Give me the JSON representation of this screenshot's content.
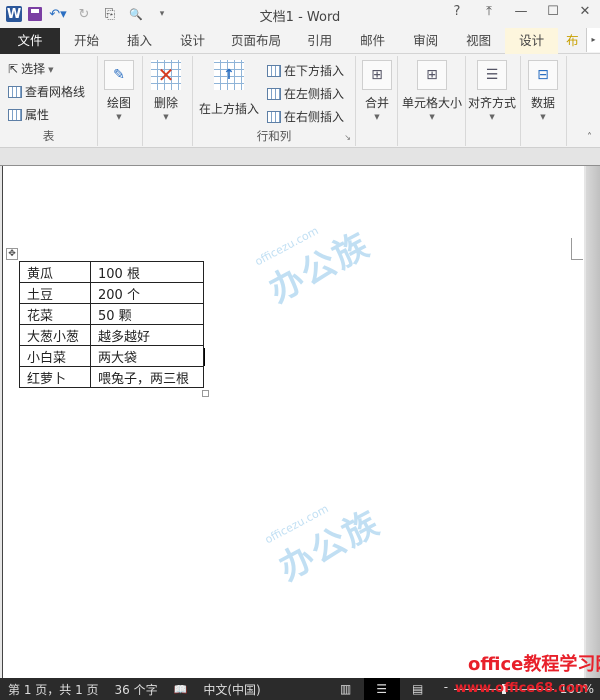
{
  "app": {
    "title": "文档1 - Word"
  },
  "quick_access": [
    {
      "name": "word-logo-icon",
      "glyph": "W"
    },
    {
      "name": "save-icon",
      "glyph": ""
    },
    {
      "name": "undo-icon",
      "glyph": "↶▾"
    },
    {
      "name": "redo-icon",
      "glyph": "↻"
    },
    {
      "name": "new-doc-icon",
      "glyph": "⎘"
    },
    {
      "name": "print-preview-icon",
      "glyph": "🔍"
    },
    {
      "name": "customize-icon",
      "glyph": "▾"
    }
  ],
  "window_controls": {
    "help": "?",
    "ribbon_display": "⤒",
    "minimize": "—",
    "maximize": "☐",
    "close": "✕"
  },
  "tabs": [
    {
      "label": "文件"
    },
    {
      "label": "开始"
    },
    {
      "label": "插入"
    },
    {
      "label": "设计"
    },
    {
      "label": "页面布局"
    },
    {
      "label": "引用"
    },
    {
      "label": "邮件"
    },
    {
      "label": "审阅"
    },
    {
      "label": "视图"
    },
    {
      "label": "设计"
    },
    {
      "label": "布"
    }
  ],
  "tab_scroll": "▸",
  "ribbon": {
    "table_group": {
      "label": "表",
      "select": "选择",
      "gridlines": "查看网格线",
      "properties": "属性"
    },
    "draw": "绘图",
    "delete": "删除",
    "rows_cols_group": {
      "label": "行和列",
      "insert_above": "在上方插入",
      "insert_below": "在下方插入",
      "insert_left": "在左侧插入",
      "insert_right": "在右侧插入",
      "launcher": "↘"
    },
    "merge": "合并",
    "cell_size": "单元格大小",
    "alignment": "对齐方式",
    "data": "数据",
    "collapse": "˄"
  },
  "document": {
    "table": [
      [
        "黄瓜",
        "100 根"
      ],
      [
        "土豆",
        "200 个"
      ],
      [
        "花菜",
        "50 颗"
      ],
      [
        "大葱小葱",
        "越多越好"
      ],
      [
        "小白菜",
        "两大袋"
      ],
      [
        "红萝卜",
        "喂兔子，两三根"
      ]
    ],
    "move_handle": "✥",
    "watermark_small": "officezu.com",
    "watermark_big": "办公族"
  },
  "status": {
    "page": "第 1 页，共 1 页",
    "words": "36 个字",
    "proof_icon": "📖",
    "language": "中文(中国)",
    "zoom_minus": "-",
    "zoom": "100%",
    "zoom_value_percent": 100
  },
  "site_watermark": {
    "line1": "office教程学习网",
    "line2": "www.office68.com"
  }
}
